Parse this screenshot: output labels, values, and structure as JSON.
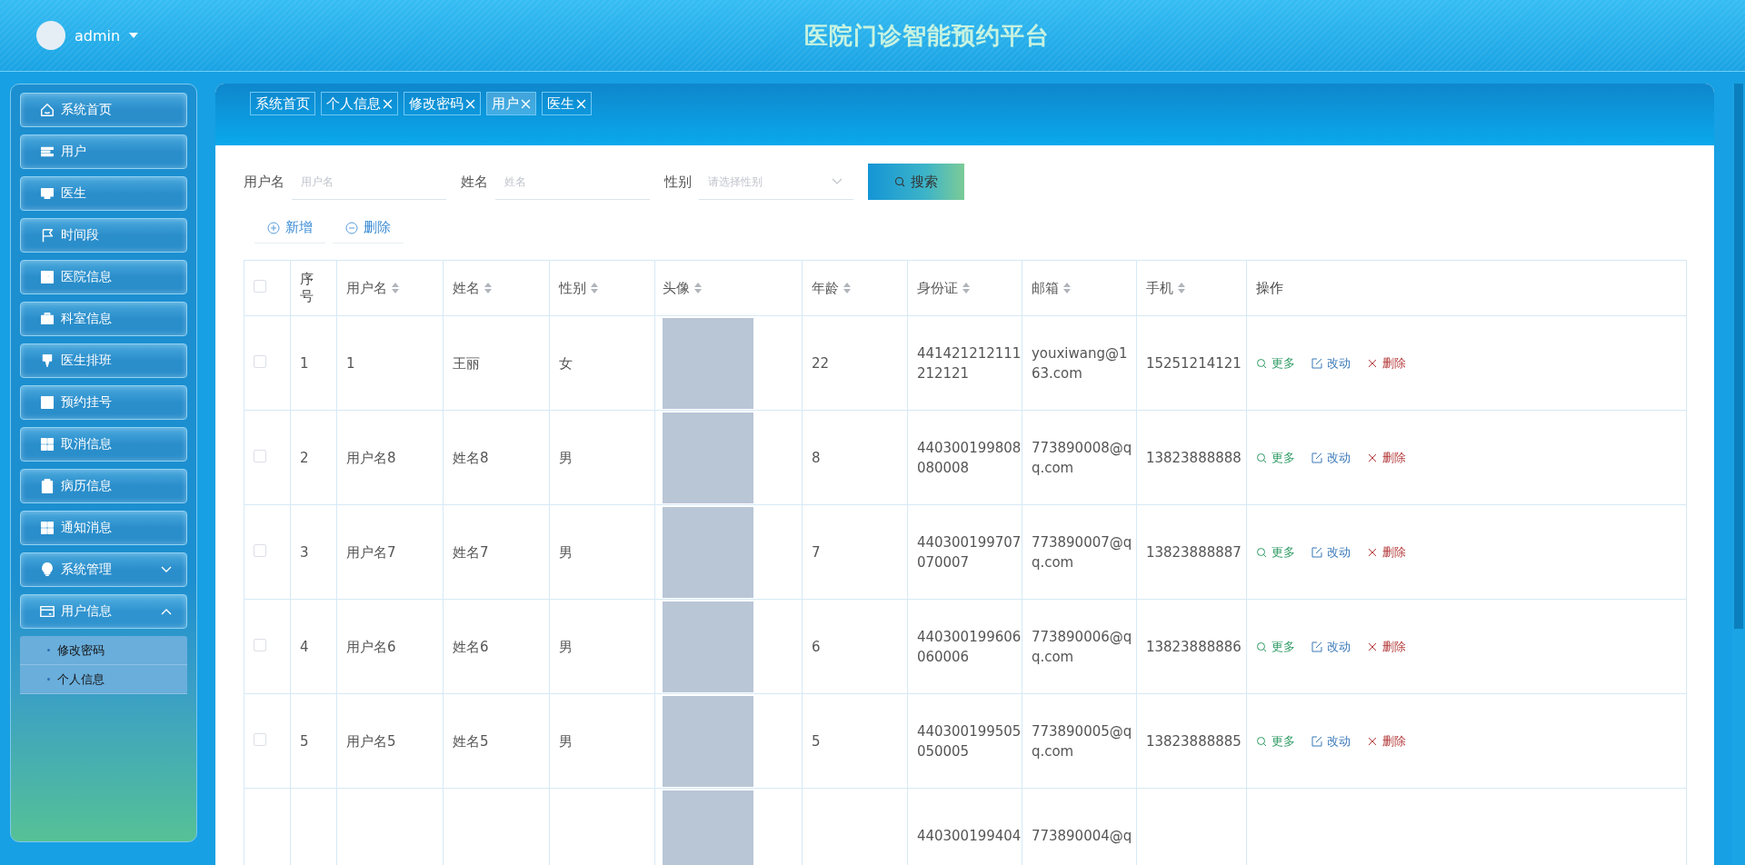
{
  "header": {
    "user": "admin",
    "title": "医院门诊智能预约平台"
  },
  "sidebar": {
    "items": [
      {
        "label": "系统首页"
      },
      {
        "label": "用户"
      },
      {
        "label": "医生"
      },
      {
        "label": "时间段"
      },
      {
        "label": "医院信息"
      },
      {
        "label": "科室信息"
      },
      {
        "label": "医生排班"
      },
      {
        "label": "预约挂号"
      },
      {
        "label": "取消信息"
      },
      {
        "label": "病历信息"
      },
      {
        "label": "通知消息"
      },
      {
        "label": "系统管理",
        "expanded": false
      },
      {
        "label": "用户信息",
        "expanded": true,
        "children": [
          {
            "label": "修改密码"
          },
          {
            "label": "个人信息"
          }
        ]
      }
    ]
  },
  "tabs": [
    {
      "label": "系统首页",
      "closable": false,
      "selected": false
    },
    {
      "label": "个人信息",
      "closable": true,
      "selected": false
    },
    {
      "label": "修改密码",
      "closable": true,
      "selected": false
    },
    {
      "label": "用户",
      "closable": true,
      "selected": true
    },
    {
      "label": "医生",
      "closable": true,
      "selected": false
    }
  ],
  "search": {
    "fields": [
      {
        "kind": "input",
        "label": "用户名",
        "placeholder": "用户名"
      },
      {
        "kind": "input",
        "label": "姓名",
        "placeholder": "姓名"
      },
      {
        "kind": "select",
        "label": "性别",
        "placeholder": "请选择性别"
      }
    ],
    "button": "搜索"
  },
  "actions": [
    {
      "label": "新增",
      "kind": "add"
    },
    {
      "label": "删除",
      "kind": "remove"
    }
  ],
  "table": {
    "all_checked": false,
    "columns": [
      {
        "label": "序号",
        "sortable": false
      },
      {
        "label": "用户名",
        "sortable": true
      },
      {
        "label": "姓名",
        "sortable": true
      },
      {
        "label": "性别",
        "sortable": true
      },
      {
        "label": "头像",
        "sortable": true
      },
      {
        "label": "年龄",
        "sortable": true
      },
      {
        "label": "身份证",
        "sortable": true
      },
      {
        "label": "邮箱",
        "sortable": true
      },
      {
        "label": "手机",
        "sortable": true
      },
      {
        "label": "操作",
        "sortable": false
      }
    ],
    "rows": [
      {
        "checked": false,
        "no": "1",
        "username": "1",
        "name": "王丽",
        "gender": "女",
        "age": "22",
        "id_card": "441421212111212121",
        "email": "youxiwang@163.com",
        "phone": "15251214121",
        "actions": [
          "更多",
          "改动",
          "删除"
        ]
      },
      {
        "checked": false,
        "no": "2",
        "username": "用户名8",
        "name": "姓名8",
        "gender": "男",
        "age": "8",
        "id_card": "440300199808080008",
        "email": "773890008@qq.com",
        "phone": "13823888888",
        "actions": [
          "更多",
          "改动",
          "删除"
        ]
      },
      {
        "checked": false,
        "no": "3",
        "username": "用户名7",
        "name": "姓名7",
        "gender": "男",
        "age": "7",
        "id_card": "440300199707070007",
        "email": "773890007@qq.com",
        "phone": "13823888887",
        "actions": [
          "更多",
          "改动",
          "删除"
        ]
      },
      {
        "checked": false,
        "no": "4",
        "username": "用户名6",
        "name": "姓名6",
        "gender": "男",
        "age": "6",
        "id_card": "440300199606060006",
        "email": "773890006@qq.com",
        "phone": "13823888886",
        "actions": [
          "更多",
          "改动",
          "删除"
        ]
      },
      {
        "checked": false,
        "no": "5",
        "username": "用户名5",
        "name": "姓名5",
        "gender": "男",
        "age": "5",
        "id_card": "440300199505050005",
        "email": "773890005@qq.com",
        "phone": "13823888885",
        "actions": [
          "更多",
          "改动",
          "删除"
        ]
      },
      {
        "id_card": "440300199404",
        "email": "773890004@q"
      }
    ]
  }
}
